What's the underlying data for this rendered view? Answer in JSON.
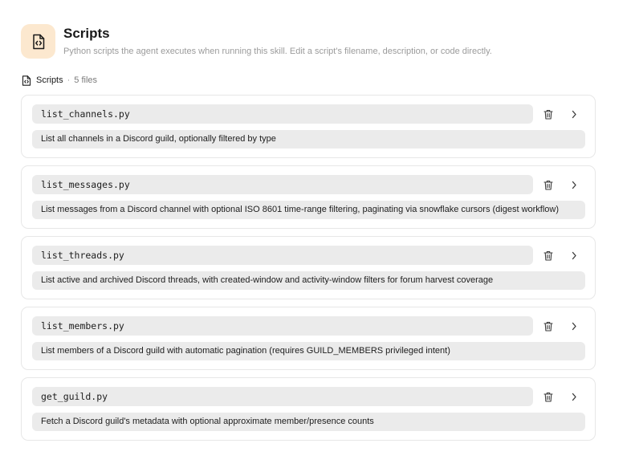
{
  "header": {
    "title": "Scripts",
    "subtitle": "Python scripts the agent executes when running this skill. Edit a script's filename, description, or code directly.",
    "icon": "code-file-icon",
    "icon_bg_color": "#fce8cf"
  },
  "section": {
    "label": "Scripts",
    "separator": "·",
    "count": "5 files",
    "icon": "code-file-icon"
  },
  "scripts": [
    {
      "filename": "list_channels.py",
      "description": "List all channels in a Discord guild, optionally filtered by type"
    },
    {
      "filename": "list_messages.py",
      "description": "List messages from a Discord channel with optional ISO 8601 time-range filtering, paginating via snowflake cursors (digest workflow)"
    },
    {
      "filename": "list_threads.py",
      "description": "List active and archived Discord threads, with created-window and activity-window filters for forum harvest coverage"
    },
    {
      "filename": "list_members.py",
      "description": "List members of a Discord guild with automatic pagination (requires GUILD_MEMBERS privileged intent)"
    },
    {
      "filename": "get_guild.py",
      "description": "Fetch a Discord guild's metadata with optional approximate member/presence counts"
    }
  ],
  "row_icons": {
    "delete": "trash-icon",
    "expand": "chevron-right-icon"
  }
}
